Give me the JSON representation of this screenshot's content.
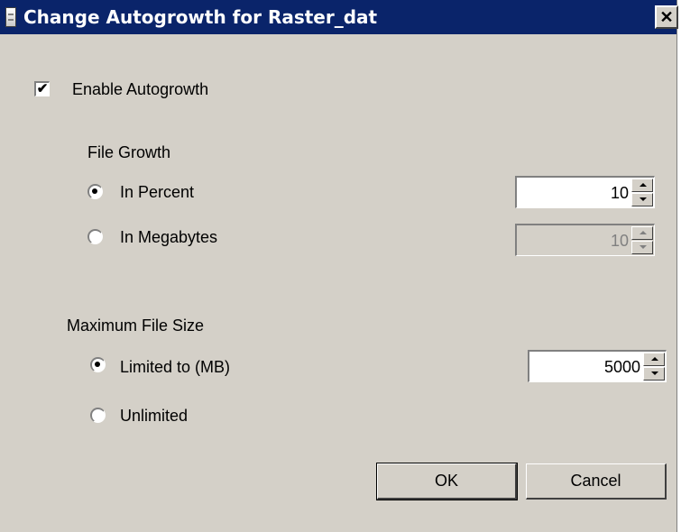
{
  "window": {
    "title": "Change Autogrowth for Raster_dat",
    "close_glyph": "✕"
  },
  "autogrowth": {
    "enable_label": "Enable Autogrowth",
    "enabled": true,
    "check_glyph": "✔"
  },
  "file_growth": {
    "heading": "File Growth",
    "percent_label": "In Percent",
    "percent_selected": true,
    "percent_value": "10",
    "megabytes_label": "In Megabytes",
    "megabytes_selected": false,
    "megabytes_value": "10"
  },
  "max_size": {
    "heading": "Maximum File Size",
    "limited_label": "Limited to (MB)",
    "limited_selected": true,
    "limited_value": "5000",
    "unlimited_label": "Unlimited",
    "unlimited_selected": false
  },
  "buttons": {
    "ok": "OK",
    "cancel": "Cancel"
  },
  "colors": {
    "titlebar": "#0a246a",
    "face": "#d4d0c8"
  }
}
